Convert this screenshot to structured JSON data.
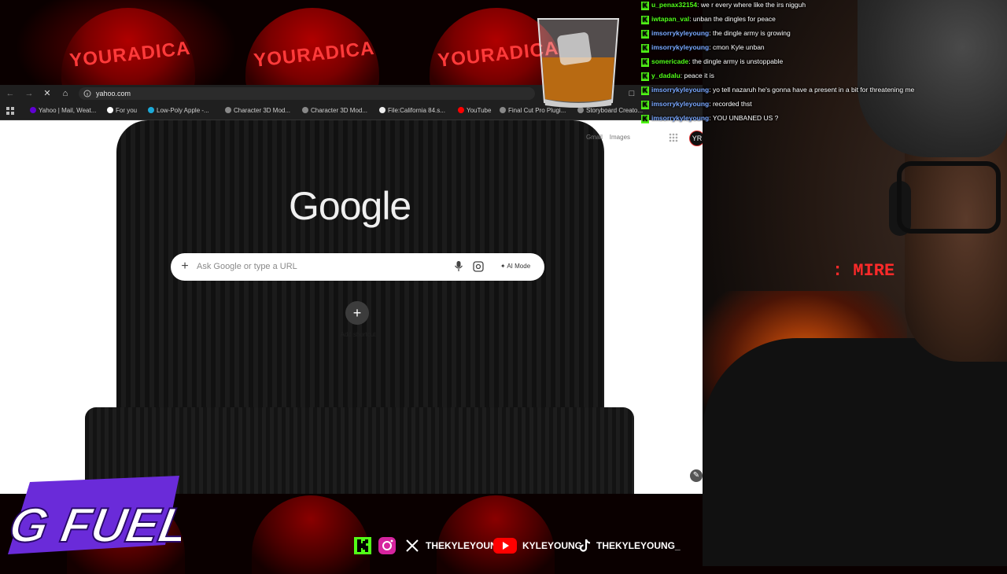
{
  "overlay": {
    "cap_text": "YOURADICA",
    "brand_logo": "G FUEL",
    "accent_red": "#ff2a2a",
    "kick_green": "#53fc18"
  },
  "browser": {
    "url": "yahoo.com",
    "bookmarks": [
      {
        "label": "Yahoo | Mail, Weat...",
        "icon": "yahoo-icon"
      },
      {
        "label": "For you",
        "icon": "x-icon"
      },
      {
        "label": "Low-Poly Apple -...",
        "icon": "sketchfab-icon"
      },
      {
        "label": "Character 3D Mod...",
        "icon": "globe-icon"
      },
      {
        "label": "Character 3D Mod...",
        "icon": "globe-icon"
      },
      {
        "label": "File:California 84.s...",
        "icon": "google-icon"
      },
      {
        "label": "YouTube",
        "icon": "youtube-icon"
      },
      {
        "label": "Final Cut Pro Plugi...",
        "icon": "globe-icon"
      },
      {
        "label": "Storyboard Creato...",
        "icon": "globe-icon"
      }
    ],
    "ntp": {
      "logo": "Google",
      "search_placeholder": "Ask Google or type a URL",
      "ai_mode_label": "AI Mode",
      "add_shortcut_label": "Add shortcut",
      "gmail_label": "Gmail",
      "images_label": "Images",
      "profile_initials": "YR"
    }
  },
  "chat": [
    {
      "user": "u_penax32154",
      "color": "#53fc18",
      "text": "we r every where like the irs nigguh"
    },
    {
      "user": "iwtapan_val",
      "color": "#53fc18",
      "text": "unban the dingles for peace"
    },
    {
      "user": "imsorrykyleyoung",
      "color": "#7aa8ff",
      "text": "the dingle army is growing"
    },
    {
      "user": "imsorrykyleyoung",
      "color": "#7aa8ff",
      "text": "cmon Kyle unban"
    },
    {
      "user": "somericade",
      "color": "#53fc18",
      "text": "the dingle army is unstoppable"
    },
    {
      "user": "y_dadalu",
      "color": "#53fc18",
      "text": "peace it is"
    },
    {
      "user": "imsorrykyleyoung",
      "color": "#7aa8ff",
      "text": "yo tell nazaruh he's gonna have a present in a bit for threatening me"
    },
    {
      "user": "imsorrykyleyoung",
      "color": "#7aa8ff",
      "text": "recorded thst"
    },
    {
      "user": "imsorrykyleyoung",
      "color": "#7aa8ff",
      "text": "YOU UNBANED US ?"
    }
  ],
  "socials": [
    {
      "platform": "kick-icon",
      "handle": ""
    },
    {
      "platform": "instagram-icon",
      "handle": ""
    },
    {
      "platform": "x-icon",
      "handle": "THEKYLEYOUNG"
    },
    {
      "platform": "youtube-icon",
      "handle": "KYLEYOUNG"
    },
    {
      "platform": "tiktok-icon",
      "handle": "THEKYLEYOUNG_"
    }
  ],
  "webcam": {
    "led_text": ": MIRE"
  }
}
